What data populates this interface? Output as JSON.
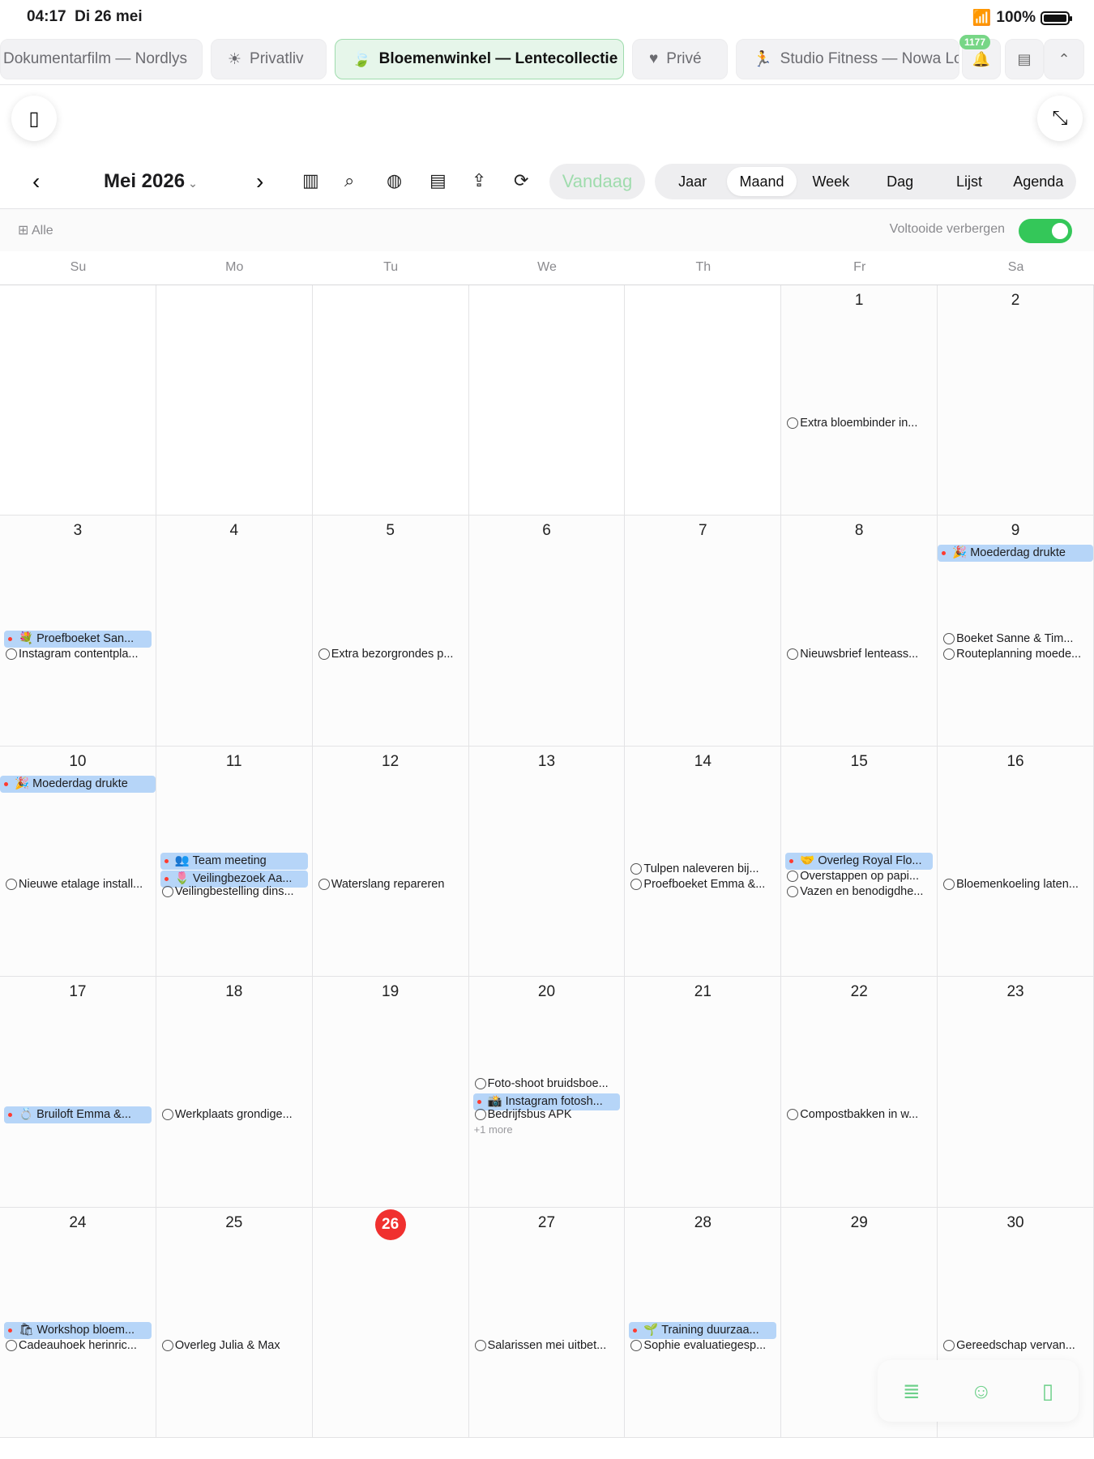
{
  "status": {
    "time": "04:17",
    "date": "Di 26 mei",
    "battery": "100%"
  },
  "tabs": [
    {
      "label": "Dokumentarfilm — Nordlys",
      "icon": ""
    },
    {
      "label": "Privatliv",
      "icon": "☀"
    },
    {
      "label": "Bloemenwinkel — Lentecollectie",
      "icon": "🍃"
    },
    {
      "label": "Privé",
      "icon": "♥"
    },
    {
      "label": "Studio Fitness — Nowa Lok",
      "icon": "🏃"
    }
  ],
  "notifications_badge": "1177",
  "toolbar": {
    "month_label": "Mei 2026",
    "today_label": "Vandaag",
    "views": [
      "Jaar",
      "Maand",
      "Week",
      "Dag",
      "Lijst",
      "Agenda"
    ],
    "selected_view": "Maand"
  },
  "filter": {
    "all_label": "Alle",
    "hide_completed_label": "Voltooide verbergen",
    "hide_completed": true
  },
  "weekdays": [
    "Su",
    "Mo",
    "Tu",
    "We",
    "Th",
    "Fr",
    "Sa"
  ],
  "calendar": {
    "today": 26,
    "weeks": [
      [
        {
          "day": ""
        },
        {
          "day": ""
        },
        {
          "day": ""
        },
        {
          "day": ""
        },
        {
          "day": ""
        },
        {
          "day": "1",
          "events": [
            {
              "type": "task",
              "text": "Extra bloembinder in..."
            }
          ]
        },
        {
          "day": "2"
        }
      ],
      [
        {
          "day": "3",
          "events": [
            {
              "type": "fill",
              "text": "💐 Proefboeket San..."
            },
            {
              "type": "task",
              "text": "Instagram contentpla..."
            }
          ]
        },
        {
          "day": "4"
        },
        {
          "day": "5",
          "events": [
            {
              "type": "task",
              "text": "Extra bezorgrondes p..."
            }
          ]
        },
        {
          "day": "6"
        },
        {
          "day": "7"
        },
        {
          "day": "8",
          "events": [
            {
              "type": "task",
              "text": "Nieuwsbrief lenteass..."
            }
          ]
        },
        {
          "day": "9",
          "allday": "🎉 Moederdag drukte",
          "events": [
            {
              "type": "task",
              "text": "Boeket Sanne & Tim..."
            },
            {
              "type": "task",
              "text": "Routeplanning moede..."
            }
          ]
        }
      ],
      [
        {
          "day": "10",
          "allday": "🎉 Moederdag drukte",
          "events": [
            {
              "type": "task",
              "text": "Nieuwe etalage install..."
            }
          ]
        },
        {
          "day": "11",
          "events": [
            {
              "type": "fill",
              "text": "👥 Team meeting"
            },
            {
              "type": "fill",
              "text": "🌷 Veilingbezoek Aa..."
            },
            {
              "type": "task",
              "text": "Veilingbestelling dins..."
            }
          ]
        },
        {
          "day": "12",
          "events": [
            {
              "type": "task",
              "text": "Waterslang repareren"
            }
          ]
        },
        {
          "day": "13"
        },
        {
          "day": "14",
          "events": [
            {
              "type": "task",
              "text": "Tulpen naleveren bij..."
            },
            {
              "type": "task",
              "text": "Proefboeket Emma &..."
            }
          ]
        },
        {
          "day": "15",
          "events": [
            {
              "type": "fill",
              "text": "🤝 Overleg Royal Flo..."
            },
            {
              "type": "task",
              "text": "Overstappen op papi..."
            },
            {
              "type": "task",
              "text": "Vazen en benodigdhe..."
            }
          ]
        },
        {
          "day": "16",
          "events": [
            {
              "type": "task",
              "text": "Bloemenkoeling laten..."
            }
          ]
        }
      ],
      [
        {
          "day": "17",
          "events": [
            {
              "type": "fill",
              "text": "💍 Bruiloft Emma &..."
            }
          ]
        },
        {
          "day": "18",
          "events": [
            {
              "type": "task",
              "text": "Werkplaats grondige..."
            }
          ]
        },
        {
          "day": "19"
        },
        {
          "day": "20",
          "events": [
            {
              "type": "task",
              "text": "Foto-shoot bruidsboe..."
            },
            {
              "type": "fill",
              "text": "📸 Instagram fotosh..."
            },
            {
              "type": "task",
              "text": "Bedrijfsbus APK"
            }
          ],
          "more": "+1 more"
        },
        {
          "day": "21"
        },
        {
          "day": "22",
          "events": [
            {
              "type": "task",
              "text": "Compostbakken in w..."
            }
          ]
        },
        {
          "day": "23"
        }
      ],
      [
        {
          "day": "24",
          "events": [
            {
              "type": "fill",
              "text": "🛍 Workshop bloem..."
            },
            {
              "type": "task",
              "text": "Cadeauhoek herinric..."
            }
          ]
        },
        {
          "day": "25",
          "events": [
            {
              "type": "task",
              "text": "Overleg Julia & Max"
            }
          ]
        },
        {
          "day": "26"
        },
        {
          "day": "27",
          "events": [
            {
              "type": "task",
              "text": "Salarissen mei uitbet..."
            }
          ]
        },
        {
          "day": "28",
          "events": [
            {
              "type": "fill",
              "text": "🌱 Training duurzaa..."
            },
            {
              "type": "task",
              "text": "Sophie evaluatiegesp..."
            }
          ]
        },
        {
          "day": "29"
        },
        {
          "day": "30",
          "events": [
            {
              "type": "task",
              "text": "Gereedschap vervan..."
            }
          ]
        }
      ]
    ]
  },
  "colors": {
    "accent": "#34c759",
    "event_fill": "#b6d5f8",
    "today": "#f0302f"
  }
}
